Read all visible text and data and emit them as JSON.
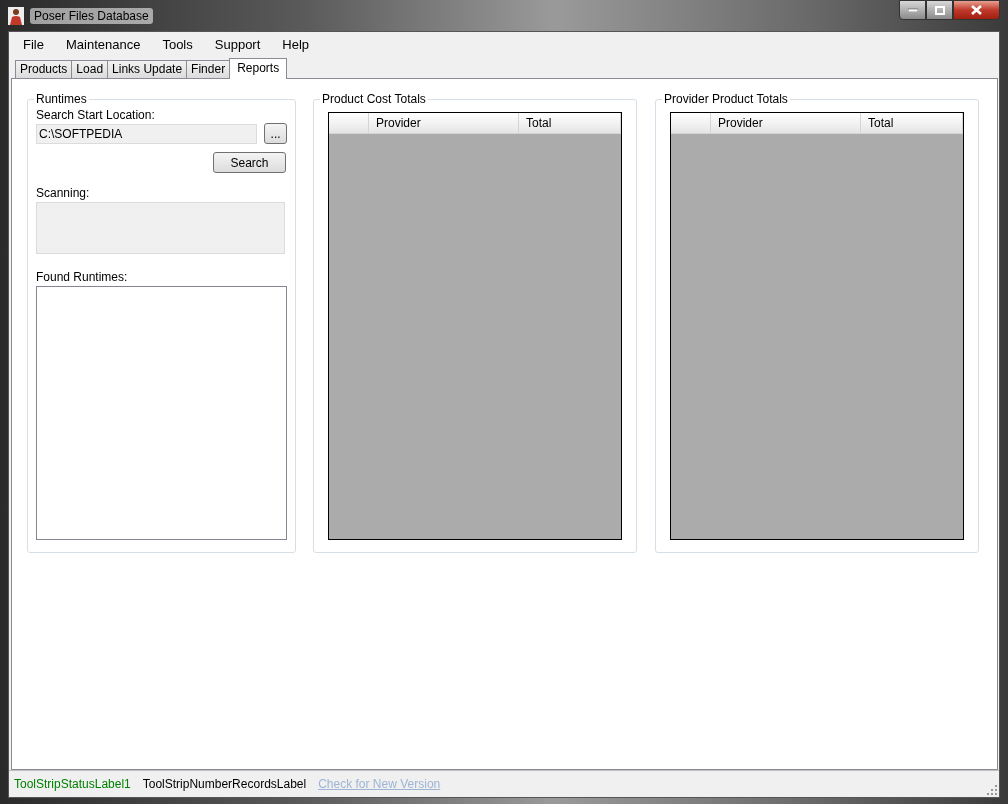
{
  "window": {
    "title": "Poser Files Database"
  },
  "menu": [
    "File",
    "Maintenance",
    "Tools",
    "Support",
    "Help"
  ],
  "tabs": [
    {
      "label": "Products",
      "selected": false
    },
    {
      "label": "Load",
      "selected": false
    },
    {
      "label": "Links Update",
      "selected": false
    },
    {
      "label": "Finder",
      "selected": false
    },
    {
      "label": "Reports",
      "selected": true
    }
  ],
  "runtimes": {
    "title": "Runtimes",
    "location_label": "Search Start Location:",
    "location_value": "C:\\SOFTPEDIA",
    "browse_button": "...",
    "search_button": "Search",
    "scanning_label": "Scanning:",
    "found_label": "Found Runtimes:"
  },
  "grids": [
    {
      "title": "Product Cost Totals",
      "columns": [
        "Provider",
        "Total"
      ]
    },
    {
      "title": "Provider Product Totals",
      "columns": [
        "Provider",
        "Total"
      ]
    }
  ],
  "status_bar": [
    {
      "text": "ToolStripStatusLabel1",
      "kind": "status"
    },
    {
      "text": "ToolStripNumberRecordsLabel",
      "kind": "plain"
    },
    {
      "text": "Check for New Version",
      "kind": "link"
    }
  ]
}
